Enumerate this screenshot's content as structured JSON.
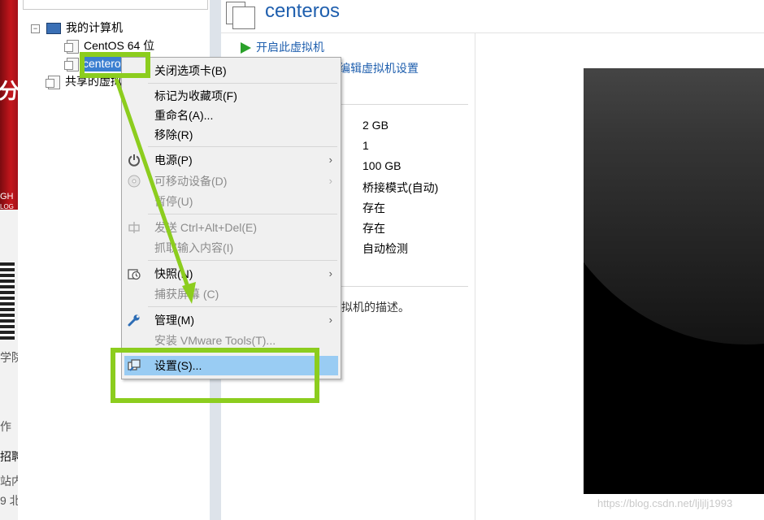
{
  "background_page": {
    "banner_text_1": "分",
    "banner_text_2": "GH",
    "banner_text_3": "LOG",
    "side_texts": [
      "学院",
      "作",
      "招聘",
      "站内",
      "9 北"
    ]
  },
  "library": {
    "root_label": "我的计算机",
    "vm_items": [
      "CentOS 64 位",
      "centeros"
    ],
    "shared_label": "共享的虚拟机"
  },
  "vm": {
    "title": "centeros",
    "start_action": "开启此虚拟机",
    "edit_action": "编辑虚拟机设置",
    "devices": [
      "2 GB",
      "1",
      "100 GB",
      "桥接模式(自动)",
      "存在",
      "存在",
      "自动检测"
    ],
    "description_tail": "拟机的描述。"
  },
  "context_menu": {
    "items": [
      {
        "label": "关闭选项卡(B)",
        "disabled": false,
        "submenu": false,
        "icon": ""
      },
      {
        "label": "标记为收藏项(F)",
        "disabled": false,
        "submenu": false,
        "icon": ""
      },
      {
        "label": "重命名(A)...",
        "disabled": false,
        "submenu": false,
        "icon": ""
      },
      {
        "label": "移除(R)",
        "disabled": false,
        "submenu": false,
        "icon": ""
      },
      {
        "label": "电源(P)",
        "disabled": false,
        "submenu": true,
        "icon": "power-icon"
      },
      {
        "label": "可移动设备(D)",
        "disabled": true,
        "submenu": true,
        "icon": "removable-device-icon"
      },
      {
        "label": "暂停(U)",
        "disabled": true,
        "submenu": false,
        "icon": ""
      },
      {
        "label": "发送 Ctrl+Alt+Del(E)",
        "disabled": true,
        "submenu": false,
        "icon": "send-keys-icon"
      },
      {
        "label": "抓取输入内容(I)",
        "disabled": true,
        "submenu": false,
        "icon": ""
      },
      {
        "label": "快照(N)",
        "disabled": false,
        "submenu": true,
        "icon": "snapshot-icon"
      },
      {
        "label": "捕获屏幕 (C)",
        "disabled": true,
        "submenu": false,
        "icon": ""
      },
      {
        "label": "管理(M)",
        "disabled": false,
        "submenu": true,
        "icon": "wrench-icon"
      },
      {
        "label": "安装 VMware Tools(T)...",
        "disabled": true,
        "submenu": false,
        "icon": ""
      },
      {
        "label": "设置(S)...",
        "disabled": false,
        "submenu": false,
        "icon": "settings-icon",
        "highlighted": true
      }
    ],
    "submenu_arrow": "›"
  },
  "watermark": "https://blog.csdn.net/ljljlj1993",
  "colors": {
    "annotation": "#8ccd1e",
    "highlight": "#99ccf3",
    "link": "#1f5fae",
    "selection": "#3b7fd1"
  }
}
